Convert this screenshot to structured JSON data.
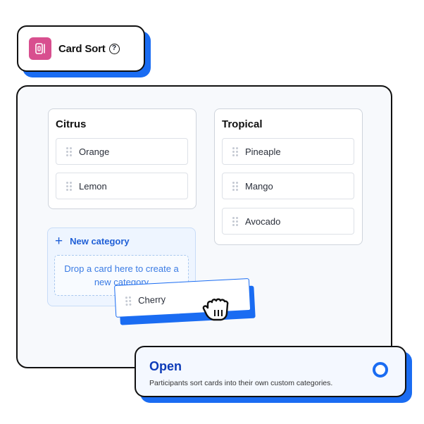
{
  "header": {
    "icon": "card-sort-icon",
    "title": "Card Sort",
    "help_icon": "question-circle-icon",
    "help_glyph": "?",
    "icon_color": "#d84f8f"
  },
  "categories": [
    {
      "title": "Citrus",
      "cards": [
        {
          "label": "Orange"
        },
        {
          "label": "Lemon"
        }
      ]
    },
    {
      "title": "Tropical",
      "cards": [
        {
          "label": "Pineaple"
        },
        {
          "label": "Mango"
        },
        {
          "label": "Avocado"
        }
      ]
    }
  ],
  "new_category": {
    "plus_glyph": "+",
    "label": "New category",
    "drop_hint": "Drop a card here to create a new category"
  },
  "dragged_card": {
    "label": "Cherry",
    "cursor": "grabbing-hand-icon"
  },
  "sort_option": {
    "title": "Open",
    "description": "Participants sort cards into their own custom categories.",
    "selected": true
  },
  "colors": {
    "accent": "#1a6cf2",
    "title_blue": "#0d3bb8",
    "link_blue": "#1f5fd6",
    "panel_bg": "#f7f9fc"
  }
}
